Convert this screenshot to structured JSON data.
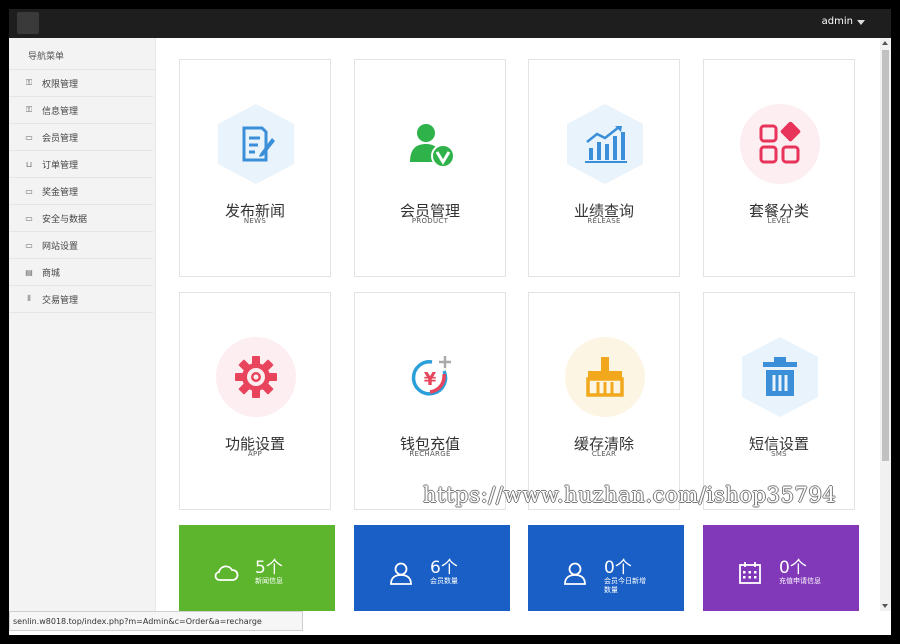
{
  "header": {
    "user_name": "admin"
  },
  "sidebar": {
    "title": "导航菜单",
    "items": [
      {
        "label": "权限管理",
        "icon": "key-icon"
      },
      {
        "label": "信息管理",
        "icon": "key-icon"
      },
      {
        "label": "会员管理",
        "icon": "tag-icon"
      },
      {
        "label": "订单管理",
        "icon": "shirt-icon"
      },
      {
        "label": "奖金管理",
        "icon": "monitor-icon"
      },
      {
        "label": "安全与数据",
        "icon": "monitor-icon"
      },
      {
        "label": "网站设置",
        "icon": "monitor-icon"
      },
      {
        "label": "商城",
        "icon": "store-icon"
      },
      {
        "label": "交易管理",
        "icon": "columns-icon"
      }
    ]
  },
  "cards": [
    {
      "title": "发布新闻",
      "sub": "NEWS",
      "icon": "news-edit-icon",
      "color": "#3b8fd9",
      "bg": "#e9f3fc"
    },
    {
      "title": "会员管理",
      "sub": "PRODUCT",
      "icon": "member-check-icon",
      "color": "#2fb24a",
      "bg": "#ffffff"
    },
    {
      "title": "业绩查询",
      "sub": "RELEASE",
      "icon": "bar-chart-icon",
      "color": "#3b8fd9",
      "bg": "#e9f3fc"
    },
    {
      "title": "套餐分类",
      "sub": "LEVEL",
      "icon": "category-grid-icon",
      "color": "#e8335a",
      "bg": "#fdeef1"
    },
    {
      "title": "功能设置",
      "sub": "APP",
      "icon": "gear-icon",
      "color": "#e8445c",
      "bg": "#fdeef1"
    },
    {
      "title": "钱包充值",
      "sub": "RECHARGE",
      "icon": "yen-recharge-icon",
      "color": "#e8445c",
      "bg": "#ffffff"
    },
    {
      "title": "缓存清除",
      "sub": "CLEAR",
      "icon": "broom-icon",
      "color": "#f2a81c",
      "bg": "#fdf5e4"
    },
    {
      "title": "短信设置",
      "sub": "SMS",
      "icon": "trash-icon",
      "color": "#3b8fd9",
      "bg": "#e9f3fc"
    }
  ],
  "stats": [
    {
      "count": "5个",
      "label": "新闻信息",
      "icon": "cloud-icon",
      "color": "#5db52e"
    },
    {
      "count": "6个",
      "label": "会员数量",
      "icon": "user-icon",
      "color": "#1a5fc5"
    },
    {
      "count": "0个",
      "label": "会员今日新增数量",
      "icon": "user-icon",
      "color": "#1a5fc5"
    },
    {
      "count": "0个",
      "label": "充值申请信息",
      "icon": "calendar-icon",
      "color": "#8239b9"
    }
  ],
  "statusbar": {
    "url": "senlin.w8018.top/index.php?m=Admin&c=Order&a=recharge"
  },
  "watermark": {
    "text": "https://www.huzhan.com/ishop35794"
  }
}
